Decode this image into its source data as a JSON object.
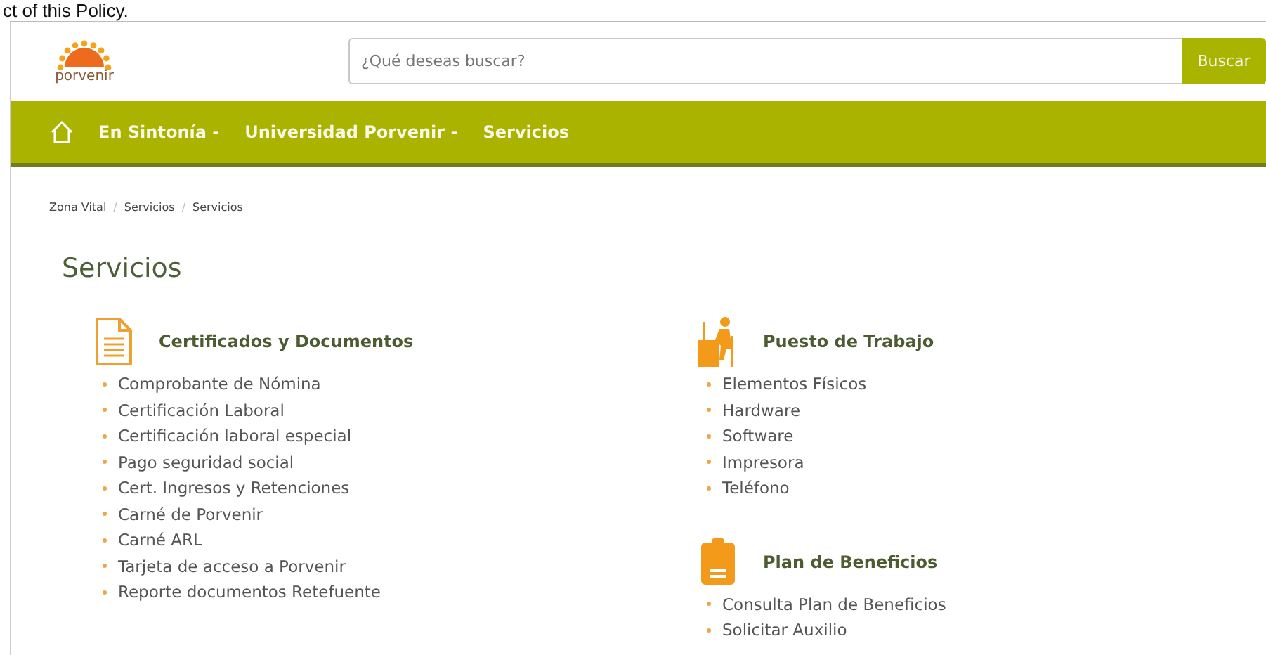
{
  "document_text": "ct of this Policy.",
  "header": {
    "logo": {
      "name": "porvenir"
    },
    "search": {
      "placeholder": "¿Qué deseas buscar?"
    },
    "search_button": "Buscar"
  },
  "nav": {
    "items": [
      {
        "label": "En Sintonía -"
      },
      {
        "label": "Universidad Porvenir -"
      },
      {
        "label": "Servicios"
      }
    ]
  },
  "breadcrumb": {
    "separator": "/",
    "items": [
      "Zona Vital",
      "Servicios",
      "Servicios"
    ]
  },
  "title": "Servicios",
  "columns": [
    [
      {
        "kind": "document",
        "title": "Certificados y Documentos",
        "items": [
          "Comprobante de Nómina",
          "Certificación Laboral",
          "Certificación laboral especial",
          "Pago seguridad social",
          "Cert. Ingresos y Retenciones",
          "Carné de Porvenir",
          "Carné ARL",
          "Tarjeta de acceso a Porvenir",
          "Reporte documentos Retefuente"
        ]
      }
    ],
    [
      {
        "kind": "desk",
        "title": "Puesto de Trabajo",
        "items": [
          "Elementos Físicos",
          "Hardware",
          "Software",
          "Impresora",
          "Teléfono"
        ]
      },
      {
        "kind": "pass",
        "title": "Plan de Beneficios",
        "items": [
          "Consulta Plan de Beneficios",
          "Solicitar Auxilio"
        ]
      }
    ]
  ]
}
